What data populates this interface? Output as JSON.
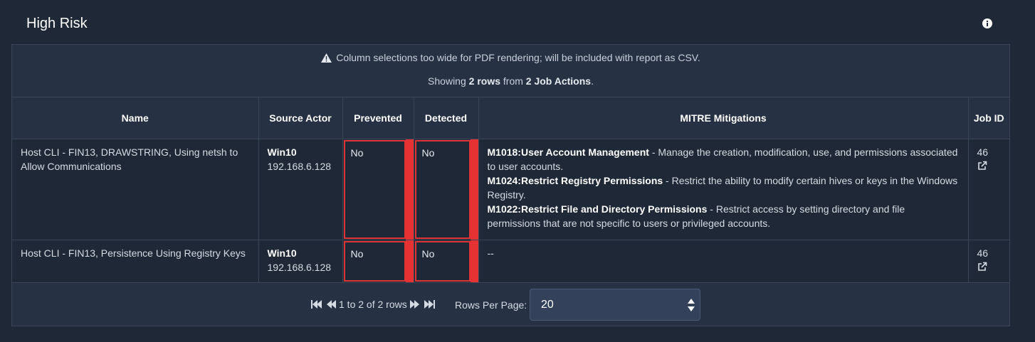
{
  "panel": {
    "title": "High Risk",
    "info_icon": "info-circle-icon"
  },
  "notice": {
    "icon": "warning-triangle-icon",
    "text": "Column selections too wide for PDF rendering; will be included with report as CSV."
  },
  "summary": {
    "prefix": "Showing",
    "rows": "2 rows",
    "middle": "from",
    "source": "2 Job Actions",
    "suffix": "."
  },
  "table": {
    "columns": [
      "Name",
      "Source Actor",
      "Prevented",
      "Detected",
      "MITRE Mitigations",
      "Job ID"
    ],
    "rows": [
      {
        "name": "Host CLI - FIN13, DRAWSTRING, Using netsh to Allow Communications",
        "actor_name": "Win10",
        "actor_ip": "192.168.6.128",
        "prevented": "No",
        "detected": "No",
        "mitigations": [
          {
            "id": "M1018:User Account Management",
            "desc": " - Manage the creation, modification, use, and permissions associated to user accounts."
          },
          {
            "id": "M1024:Restrict Registry Permissions",
            "desc": " - Restrict the ability to modify certain hives or keys in the Windows Registry."
          },
          {
            "id": "M1022:Restrict File and Directory Permissions",
            "desc": " - Restrict access by setting directory and file permissions that are not specific to users or privileged accounts."
          }
        ],
        "job_id": "46"
      },
      {
        "name": "Host CLI - FIN13, Persistence Using Registry Keys",
        "actor_name": "Win10",
        "actor_ip": "192.168.6.128",
        "prevented": "No",
        "detected": "No",
        "mitigations_text": "--",
        "job_id": "46"
      }
    ],
    "status_color": "#e63232",
    "link_icon": "external-link-icon"
  },
  "pagination": {
    "range_text": "1 to 2 of 2 rows",
    "rows_per_page_label": "Rows Per Page:",
    "rows_per_page_value": "20"
  }
}
